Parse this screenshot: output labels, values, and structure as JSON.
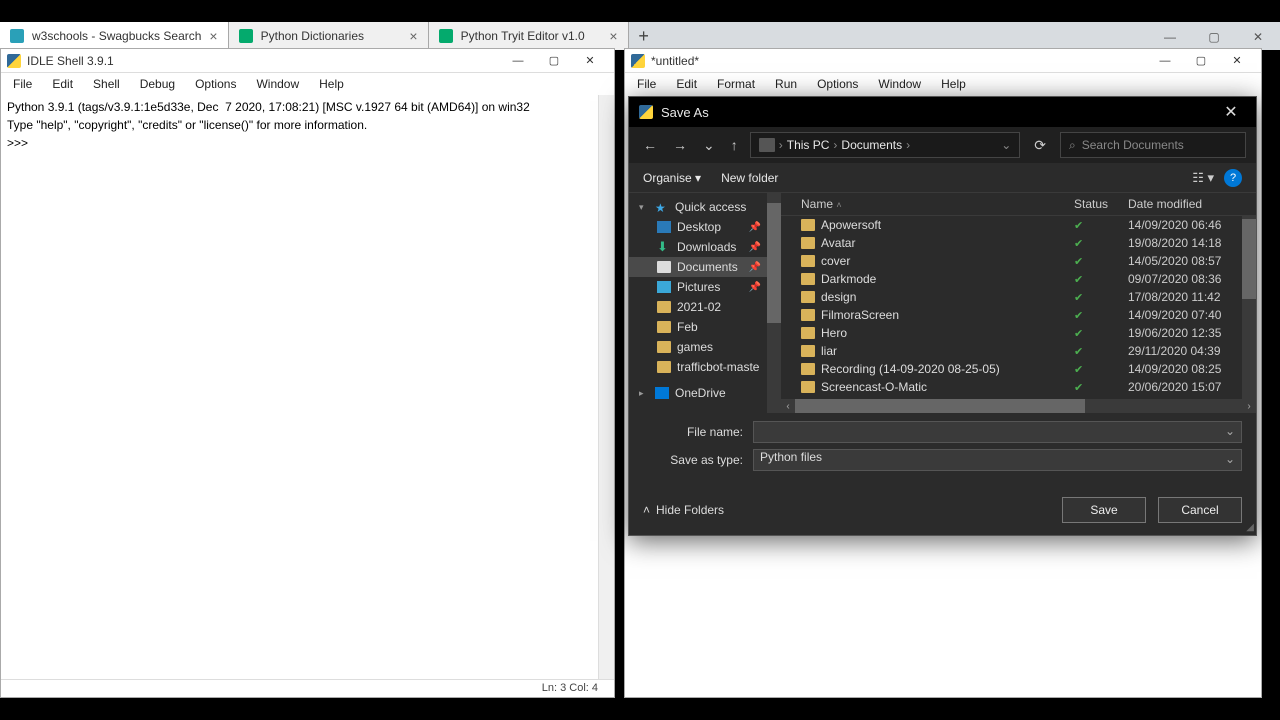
{
  "browser": {
    "tabs": [
      {
        "label": "w3schools - Swagbucks Search"
      },
      {
        "label": "Python Dictionaries"
      },
      {
        "label": "Python Tryit Editor v1.0"
      }
    ],
    "min": "—",
    "max": "▢",
    "close": "✕"
  },
  "idle": {
    "title": "IDLE Shell 3.9.1",
    "menu": [
      "File",
      "Edit",
      "Shell",
      "Debug",
      "Options",
      "Window",
      "Help"
    ],
    "content_line1": "Python 3.9.1 (tags/v3.9.1:1e5d33e, Dec  7 2020, 17:08:21) [MSC v.1927 64 bit (AMD64)] on win32",
    "content_line2": "Type \"help\", \"copyright\", \"credits\" or \"license()\" for more information.",
    "prompt": ">>> ",
    "status": "Ln: 3   Col: 4"
  },
  "editor": {
    "title": "*untitled*",
    "menu": [
      "File",
      "Edit",
      "Format",
      "Run",
      "Options",
      "Window",
      "Help"
    ]
  },
  "dialog": {
    "title": "Save As",
    "breadcrumb": [
      "This PC",
      "Documents"
    ],
    "search_placeholder": "Search Documents",
    "organise": "Organise",
    "new_folder": "New folder",
    "tree": {
      "quick_access": "Quick access",
      "items": [
        {
          "label": "Desktop",
          "pinned": true
        },
        {
          "label": "Downloads",
          "pinned": true
        },
        {
          "label": "Documents",
          "pinned": true,
          "selected": true
        },
        {
          "label": "Pictures",
          "pinned": true
        },
        {
          "label": "2021-02",
          "pinned": false
        },
        {
          "label": "Feb",
          "pinned": false
        },
        {
          "label": "games",
          "pinned": false
        },
        {
          "label": "trafficbot-maste",
          "pinned": false
        }
      ],
      "onedrive": "OneDrive"
    },
    "columns": {
      "name": "Name",
      "status": "Status",
      "date": "Date modified"
    },
    "files": [
      {
        "name": "Apowersoft",
        "date": "14/09/2020 06:46"
      },
      {
        "name": "Avatar",
        "date": "19/08/2020 14:18"
      },
      {
        "name": "cover",
        "date": "14/05/2020 08:57"
      },
      {
        "name": "Darkmode",
        "date": "09/07/2020 08:36"
      },
      {
        "name": "design",
        "date": "17/08/2020 11:42"
      },
      {
        "name": "FilmoraScreen",
        "date": "14/09/2020 07:40"
      },
      {
        "name": "Hero",
        "date": "19/06/2020 12:35"
      },
      {
        "name": "liar",
        "date": "29/11/2020 04:39"
      },
      {
        "name": "Recording (14-09-2020 08-25-05)",
        "date": "14/09/2020 08:25"
      },
      {
        "name": "Screencast-O-Matic",
        "date": "20/06/2020 15:07"
      }
    ],
    "file_name_label": "File name:",
    "file_name_value": "",
    "save_type_label": "Save as type:",
    "save_type_value": "Python files",
    "hide_folders": "Hide Folders",
    "save": "Save",
    "cancel": "Cancel"
  }
}
